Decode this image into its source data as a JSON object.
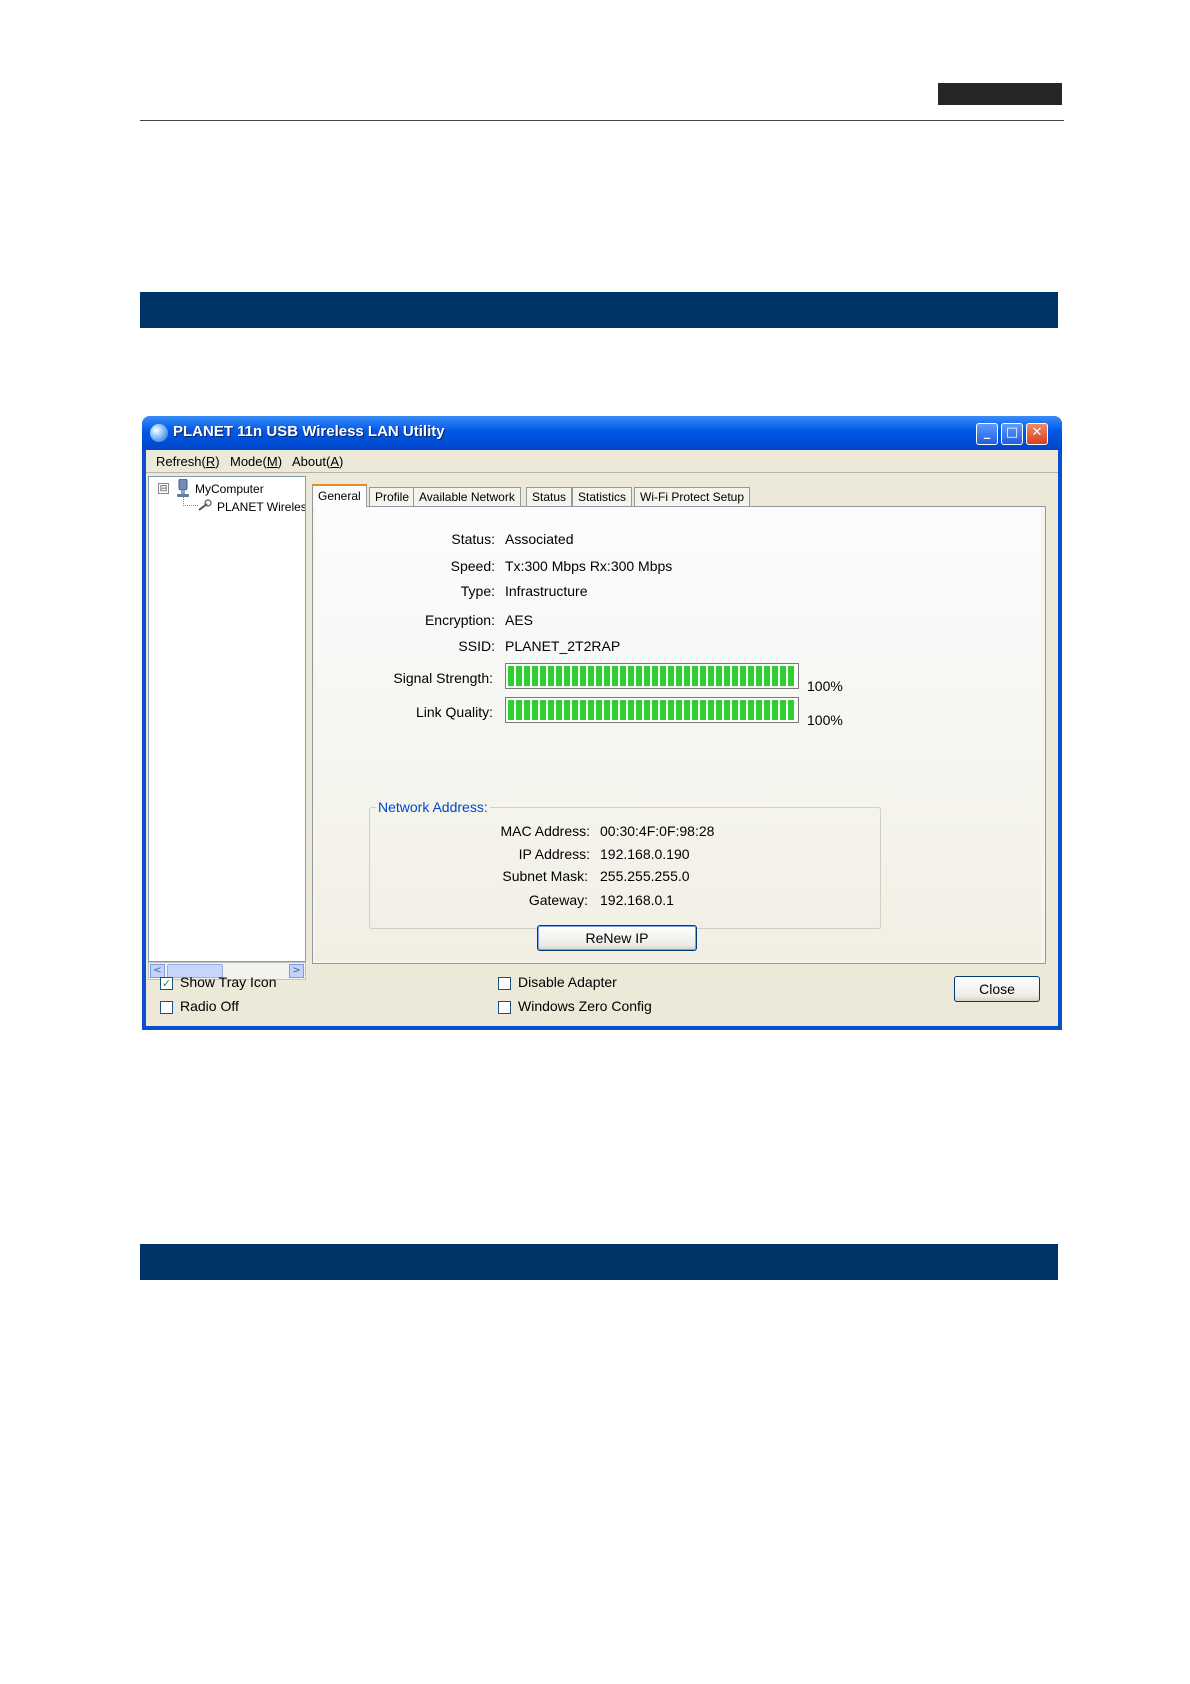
{
  "window": {
    "title": "PLANET 11n USB Wireless LAN Utility",
    "controls": {
      "minimize": "_",
      "maximize": "□",
      "close": "✕"
    }
  },
  "menu": [
    {
      "label": "Refresh(",
      "key": "R",
      "tail": ")"
    },
    {
      "label": "Mode(",
      "key": "M",
      "tail": ")"
    },
    {
      "label": "About(",
      "key": "A",
      "tail": ")"
    }
  ],
  "tree": {
    "toggle": "⊟",
    "root": "MyComputer",
    "child": "PLANET Wireless"
  },
  "scrollbar": {
    "left": "<",
    "right": ">"
  },
  "tabs": [
    "General",
    "Profile",
    "Available Network",
    "Status",
    "Statistics",
    "Wi-Fi Protect Setup"
  ],
  "general": {
    "status_label": "Status:",
    "status": "Associated",
    "speed_label": "Speed:",
    "speed": "Tx:300 Mbps Rx:300 Mbps",
    "type_label": "Type:",
    "type": "Infrastructure",
    "encryption_label": "Encryption:",
    "encryption": "AES",
    "ssid_label": "SSID:",
    "ssid": "PLANET_2T2RAP",
    "signal_label": "Signal Strength:",
    "signal_value": 100,
    "signal_text": "100%",
    "quality_label": "Link Quality:",
    "quality_value": 100,
    "quality_text": "100%",
    "bar_color": "#2fcf2f"
  },
  "network": {
    "title": "Network Address:",
    "mac_label": "MAC Address:",
    "mac": "00:30:4F:0F:98:28",
    "ip_label": "IP Address:",
    "ip": "192.168.0.190",
    "mask_label": "Subnet Mask:",
    "mask": "255.255.255.0",
    "gw_label": "Gateway:",
    "gw": "192.168.0.1"
  },
  "buttons": {
    "renew": "ReNew IP",
    "close": "Close"
  },
  "options": {
    "show_tray": {
      "label": "Show Tray Icon",
      "checked": true,
      "mark": "✓"
    },
    "radio_off": {
      "label": "Radio Off",
      "checked": false
    },
    "disable_adapter": {
      "label": "Disable Adapter",
      "checked": false
    },
    "wzc": {
      "label": "Windows Zero Config",
      "checked": false
    }
  },
  "colors": {
    "band": "#003366",
    "titlebar": "#0058e6",
    "accent_tab": "#e68b2c",
    "group_title": "#0046d5"
  }
}
